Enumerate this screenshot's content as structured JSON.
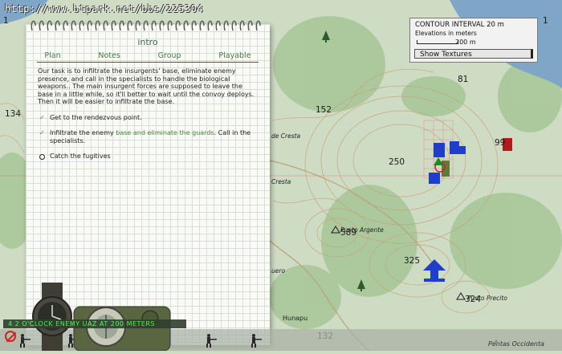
{
  "watermark": "http://www.btpark.net/bbs/225304",
  "notebook": {
    "title": "intro",
    "tabs": [
      "Plan",
      "Notes",
      "Group",
      "Playable"
    ],
    "active_tab": "Plan",
    "briefing": "Our task is to infiltrate the insurgents' base, eliminate enemy presence, and call in the specialists to handle the biological weapons.. The main insurgent forces are supposed to leave the base in a little while, so it'll better to wait until the convoy deploys. Then it will be easier to infiltrate the base.",
    "tasks": [
      {
        "status": "done",
        "text": "Get to the rendezvous point.",
        "pre": "",
        "link": "",
        "post": ""
      },
      {
        "status": "done",
        "text": "",
        "pre": "Infiltrate the enemy ",
        "link": "base and eliminate the guards",
        "post": ". Call in the specialists."
      },
      {
        "status": "current",
        "text": "Catch the fugitives",
        "pre": "",
        "link": "",
        "post": ""
      }
    ]
  },
  "contour": {
    "title": "CONTOUR INTERVAL 20 m",
    "subtitle": "Elevations in meters",
    "scale": "200 m",
    "button": "Show Textures"
  },
  "map": {
    "elevations": [
      "1",
      "1",
      "134",
      "152",
      "81",
      "250",
      "99",
      "325",
      "132",
      "589",
      "324"
    ],
    "places": [
      "de Cresta",
      "Cresta",
      "Punto Argente",
      "Punto Precito",
      "uero",
      "Hunapu",
      "Pentas Occidenta"
    ]
  },
  "hint": "4  2 O'CLOCK ENEMY UAZ AT 200 METERS",
  "colors": {
    "land": "#cfdcc4",
    "forest": "#a9c79a",
    "water": "#7fa6c6",
    "contour": "#c6a277",
    "blufor": "#1f3ec9",
    "enemy": "#b01c1c",
    "hint": "#50ff50"
  }
}
